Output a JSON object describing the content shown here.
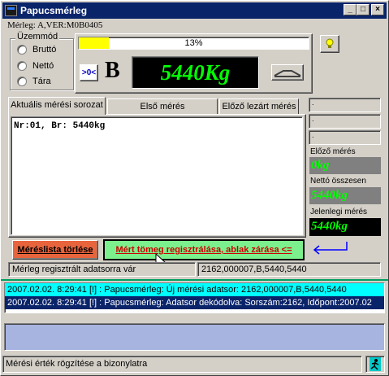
{
  "window": {
    "title": "Papucsmérleg",
    "minimize_glyph": "_",
    "maximize_glyph": "□",
    "close_glyph": "×"
  },
  "scale_info": "Mérleg: A,VER:M0B0405",
  "mode": {
    "group_label": "Üzemmód",
    "options": [
      "Bruttó",
      "Nettó",
      "Tára"
    ]
  },
  "progress": {
    "label": "13%",
    "value": 0.13
  },
  "zero_button_label": ">0<",
  "scale_letter": "B",
  "weight_display": "5440Kg",
  "tabs": [
    "Aktuális mérési sorozat",
    "Első mérés tengelytömegek",
    "Előző lezárt mérés"
  ],
  "measurement_text": "Nr:01, Br: 5440kg",
  "side_panel": {
    "prev_label": "Előző mérés",
    "prev_value": "0kg",
    "net_label": "Nettó összesen",
    "net_value": "5440kg",
    "current_label": "Jelenlegi mérés",
    "current_value": "5440kg"
  },
  "buttons": {
    "clear_list": "Méréslista törlése",
    "register": "Mért tömeg regisztrálása, ablak zárása <="
  },
  "status": {
    "left": "Mérleg regisztrált adatsorra vár",
    "right": "2162,000007,B,5440,5440"
  },
  "log": [
    {
      "time": "2007.02.02. 8:29:41",
      "tag": "[!]",
      "message": ": Papucsmérleg: Új mérési adatsor:  2162,000007,B,5440,5440"
    },
    {
      "time": "2007.02.02. 8:29:41",
      "tag": "[!]",
      "message": ": Papucsmérleg: Adatsor dekódolva: Sorszám:2162, Időpont:2007.02"
    }
  ],
  "statusbar": "Mérési érték rögzítése a bizonylatra",
  "colors": {
    "titlebar": "#0a246a",
    "display_green": "#00ff00",
    "clear_button": "#e8643c",
    "register_button": "#7cf08c",
    "log_cyan": "#00ffff",
    "log_navy": "#0a246a",
    "log_lower": "#a8b4e0"
  }
}
